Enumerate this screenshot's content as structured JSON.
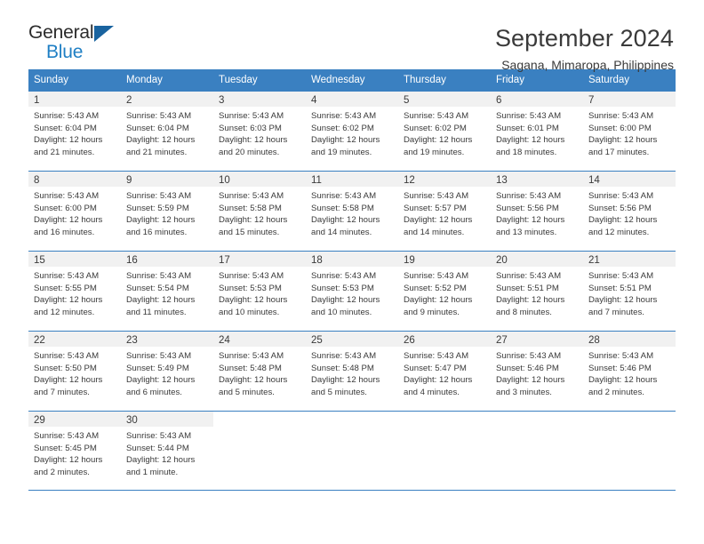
{
  "brand": {
    "name_top": "General",
    "name_bottom": "Blue",
    "accent_color": "#1f7fc4",
    "triangle_color": "#19639f"
  },
  "header": {
    "title": "September 2024",
    "subtitle": "Sagana, Mimaropa, Philippines"
  },
  "theme": {
    "header_bar_color": "#3a80c1",
    "daynum_strip_color": "#f1f1f1",
    "text_color": "#3a3a3a"
  },
  "weekday_headers": [
    "Sunday",
    "Monday",
    "Tuesday",
    "Wednesday",
    "Thursday",
    "Friday",
    "Saturday"
  ],
  "weeks": [
    [
      {
        "day": "1",
        "lines": [
          "Sunrise: 5:43 AM",
          "Sunset: 6:04 PM",
          "Daylight: 12 hours",
          "and 21 minutes."
        ]
      },
      {
        "day": "2",
        "lines": [
          "Sunrise: 5:43 AM",
          "Sunset: 6:04 PM",
          "Daylight: 12 hours",
          "and 21 minutes."
        ]
      },
      {
        "day": "3",
        "lines": [
          "Sunrise: 5:43 AM",
          "Sunset: 6:03 PM",
          "Daylight: 12 hours",
          "and 20 minutes."
        ]
      },
      {
        "day": "4",
        "lines": [
          "Sunrise: 5:43 AM",
          "Sunset: 6:02 PM",
          "Daylight: 12 hours",
          "and 19 minutes."
        ]
      },
      {
        "day": "5",
        "lines": [
          "Sunrise: 5:43 AM",
          "Sunset: 6:02 PM",
          "Daylight: 12 hours",
          "and 19 minutes."
        ]
      },
      {
        "day": "6",
        "lines": [
          "Sunrise: 5:43 AM",
          "Sunset: 6:01 PM",
          "Daylight: 12 hours",
          "and 18 minutes."
        ]
      },
      {
        "day": "7",
        "lines": [
          "Sunrise: 5:43 AM",
          "Sunset: 6:00 PM",
          "Daylight: 12 hours",
          "and 17 minutes."
        ]
      }
    ],
    [
      {
        "day": "8",
        "lines": [
          "Sunrise: 5:43 AM",
          "Sunset: 6:00 PM",
          "Daylight: 12 hours",
          "and 16 minutes."
        ]
      },
      {
        "day": "9",
        "lines": [
          "Sunrise: 5:43 AM",
          "Sunset: 5:59 PM",
          "Daylight: 12 hours",
          "and 16 minutes."
        ]
      },
      {
        "day": "10",
        "lines": [
          "Sunrise: 5:43 AM",
          "Sunset: 5:58 PM",
          "Daylight: 12 hours",
          "and 15 minutes."
        ]
      },
      {
        "day": "11",
        "lines": [
          "Sunrise: 5:43 AM",
          "Sunset: 5:58 PM",
          "Daylight: 12 hours",
          "and 14 minutes."
        ]
      },
      {
        "day": "12",
        "lines": [
          "Sunrise: 5:43 AM",
          "Sunset: 5:57 PM",
          "Daylight: 12 hours",
          "and 14 minutes."
        ]
      },
      {
        "day": "13",
        "lines": [
          "Sunrise: 5:43 AM",
          "Sunset: 5:56 PM",
          "Daylight: 12 hours",
          "and 13 minutes."
        ]
      },
      {
        "day": "14",
        "lines": [
          "Sunrise: 5:43 AM",
          "Sunset: 5:56 PM",
          "Daylight: 12 hours",
          "and 12 minutes."
        ]
      }
    ],
    [
      {
        "day": "15",
        "lines": [
          "Sunrise: 5:43 AM",
          "Sunset: 5:55 PM",
          "Daylight: 12 hours",
          "and 12 minutes."
        ]
      },
      {
        "day": "16",
        "lines": [
          "Sunrise: 5:43 AM",
          "Sunset: 5:54 PM",
          "Daylight: 12 hours",
          "and 11 minutes."
        ]
      },
      {
        "day": "17",
        "lines": [
          "Sunrise: 5:43 AM",
          "Sunset: 5:53 PM",
          "Daylight: 12 hours",
          "and 10 minutes."
        ]
      },
      {
        "day": "18",
        "lines": [
          "Sunrise: 5:43 AM",
          "Sunset: 5:53 PM",
          "Daylight: 12 hours",
          "and 10 minutes."
        ]
      },
      {
        "day": "19",
        "lines": [
          "Sunrise: 5:43 AM",
          "Sunset: 5:52 PM",
          "Daylight: 12 hours",
          "and 9 minutes."
        ]
      },
      {
        "day": "20",
        "lines": [
          "Sunrise: 5:43 AM",
          "Sunset: 5:51 PM",
          "Daylight: 12 hours",
          "and 8 minutes."
        ]
      },
      {
        "day": "21",
        "lines": [
          "Sunrise: 5:43 AM",
          "Sunset: 5:51 PM",
          "Daylight: 12 hours",
          "and 7 minutes."
        ]
      }
    ],
    [
      {
        "day": "22",
        "lines": [
          "Sunrise: 5:43 AM",
          "Sunset: 5:50 PM",
          "Daylight: 12 hours",
          "and 7 minutes."
        ]
      },
      {
        "day": "23",
        "lines": [
          "Sunrise: 5:43 AM",
          "Sunset: 5:49 PM",
          "Daylight: 12 hours",
          "and 6 minutes."
        ]
      },
      {
        "day": "24",
        "lines": [
          "Sunrise: 5:43 AM",
          "Sunset: 5:48 PM",
          "Daylight: 12 hours",
          "and 5 minutes."
        ]
      },
      {
        "day": "25",
        "lines": [
          "Sunrise: 5:43 AM",
          "Sunset: 5:48 PM",
          "Daylight: 12 hours",
          "and 5 minutes."
        ]
      },
      {
        "day": "26",
        "lines": [
          "Sunrise: 5:43 AM",
          "Sunset: 5:47 PM",
          "Daylight: 12 hours",
          "and 4 minutes."
        ]
      },
      {
        "day": "27",
        "lines": [
          "Sunrise: 5:43 AM",
          "Sunset: 5:46 PM",
          "Daylight: 12 hours",
          "and 3 minutes."
        ]
      },
      {
        "day": "28",
        "lines": [
          "Sunrise: 5:43 AM",
          "Sunset: 5:46 PM",
          "Daylight: 12 hours",
          "and 2 minutes."
        ]
      }
    ],
    [
      {
        "day": "29",
        "lines": [
          "Sunrise: 5:43 AM",
          "Sunset: 5:45 PM",
          "Daylight: 12 hours",
          "and 2 minutes."
        ]
      },
      {
        "day": "30",
        "lines": [
          "Sunrise: 5:43 AM",
          "Sunset: 5:44 PM",
          "Daylight: 12 hours",
          "and 1 minute."
        ]
      },
      {
        "day": "",
        "lines": []
      },
      {
        "day": "",
        "lines": []
      },
      {
        "day": "",
        "lines": []
      },
      {
        "day": "",
        "lines": []
      },
      {
        "day": "",
        "lines": []
      }
    ]
  ]
}
